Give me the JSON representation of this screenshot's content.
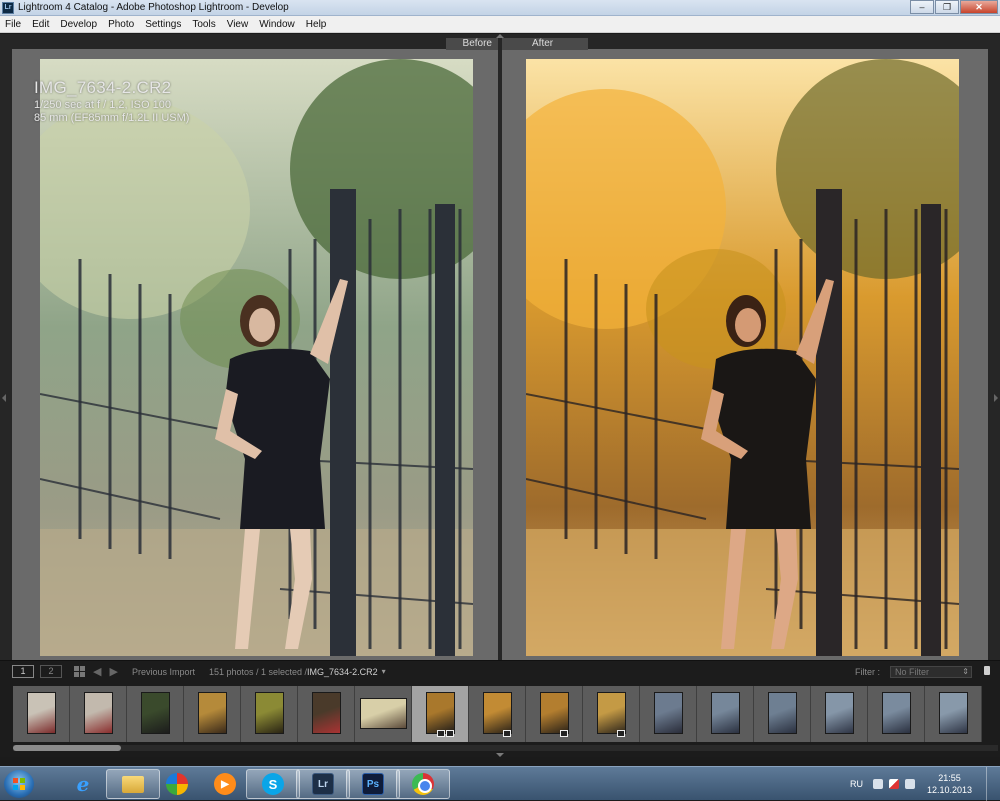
{
  "window": {
    "app_icon": "Lr",
    "title": "Lightroom 4 Catalog - Adobe Photoshop Lightroom - Develop",
    "controls": {
      "minimize": "–",
      "restore": "❐",
      "close": "✕"
    }
  },
  "menu": [
    "File",
    "Edit",
    "Develop",
    "Photo",
    "Settings",
    "Tools",
    "View",
    "Window",
    "Help"
  ],
  "compare": {
    "before_label": "Before",
    "after_label": "After",
    "info": {
      "filename": "IMG_7634-2.CR2",
      "exposure": "1/250 sec at f / 1,2, ISO 100",
      "lens": "85 mm (EF85mm f/1.2L II USM)"
    },
    "colors": {
      "before_tint": "#8fa488",
      "after_tint": "#d99a2e"
    }
  },
  "filmstrip": {
    "page1": "1",
    "page2": "2",
    "back": "◀",
    "forward": "▶",
    "source": "Previous Import",
    "count": "151 photos / 1 selected /",
    "current_file": "IMG_7634-2.CR2",
    "caret": "▾",
    "filter_label": "Filter :",
    "filter_value": "No Filter",
    "thumbnails": [
      {
        "style": "light",
        "colors": [
          "#c9c2b6",
          "#7c2b2b"
        ],
        "badge": false
      },
      {
        "style": "light",
        "colors": [
          "#c2b9ad",
          "#8a2d2d"
        ],
        "badge": false
      },
      {
        "style": "dark",
        "colors": [
          "#3a4a2c",
          "#1c1c1c"
        ],
        "badge": false
      },
      {
        "style": "warm",
        "colors": [
          "#b58a3a",
          "#3a2a1a"
        ],
        "badge": false
      },
      {
        "style": "warm",
        "colors": [
          "#8b8a35",
          "#2a2414"
        ],
        "badge": false
      },
      {
        "style": "dark",
        "colors": [
          "#4a3a2a",
          "#a33"
        ],
        "badge": false
      },
      {
        "style": "landscape",
        "colors": [
          "#d8cfa8",
          "#5b4a3a"
        ],
        "badge": false
      },
      {
        "style": "selected",
        "colors": [
          "#a9782c",
          "#1e1b18"
        ],
        "badge": true
      },
      {
        "style": "warm",
        "colors": [
          "#c28b34",
          "#2a2218"
        ],
        "badge": true
      },
      {
        "style": "warm",
        "colors": [
          "#b37e2f",
          "#2a2218"
        ],
        "badge": true
      },
      {
        "style": "warm",
        "colors": [
          "#c49a45",
          "#2d251b"
        ],
        "badge": true
      },
      {
        "style": "cool",
        "colors": [
          "#6c7b8f",
          "#2a2d3a"
        ],
        "badge": false
      },
      {
        "style": "cool",
        "colors": [
          "#76879a",
          "#2b3140"
        ],
        "badge": false
      },
      {
        "style": "cool",
        "colors": [
          "#6e7f92",
          "#2b3140"
        ],
        "badge": false
      },
      {
        "style": "cool",
        "colors": [
          "#8596a8",
          "#2f3545"
        ],
        "badge": false
      },
      {
        "style": "cool",
        "colors": [
          "#7a8b9e",
          "#2b3140"
        ],
        "badge": false
      },
      {
        "style": "cool",
        "colors": [
          "#8899aa",
          "#2f3545"
        ],
        "badge": false
      }
    ],
    "selected_index": 7,
    "scroll_fraction": 0.11
  },
  "taskbar": {
    "apps": [
      {
        "name": "internet-explorer",
        "glyph": "e"
      },
      {
        "name": "file-explorer",
        "glyph": ""
      },
      {
        "name": "picasa",
        "glyph": ""
      },
      {
        "name": "media-player",
        "glyph": "▶"
      },
      {
        "name": "skype",
        "glyph": "S"
      },
      {
        "name": "lightroom",
        "glyph": "Lr"
      },
      {
        "name": "photoshop",
        "glyph": "Ps"
      },
      {
        "name": "chrome",
        "glyph": ""
      }
    ],
    "active_apps": [
      "lightroom",
      "photoshop",
      "chrome",
      "skype",
      "file-explorer"
    ],
    "language": "RU",
    "time": "21:55",
    "date": "12.10.2013"
  }
}
